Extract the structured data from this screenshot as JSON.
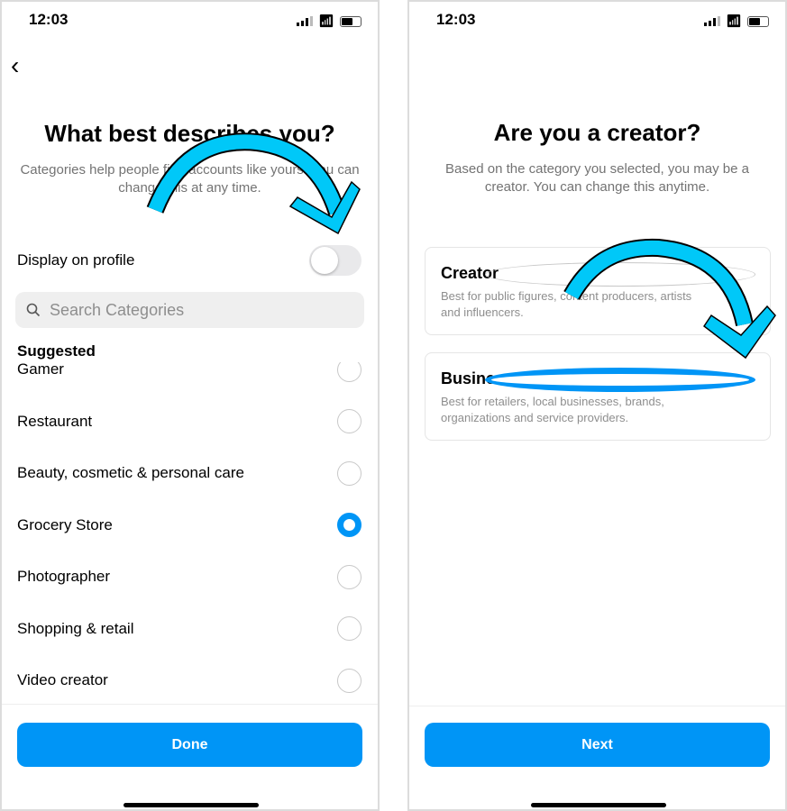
{
  "left": {
    "time": "12:03",
    "title": "What best describes you?",
    "subtitle": "Categories help people find accounts like yours. You can change this at any time.",
    "display_on_profile": "Display on profile",
    "display_on_profile_enabled": false,
    "search_placeholder": "Search Categories",
    "section": "Suggested",
    "items": [
      {
        "label": "Gamer",
        "selected": false
      },
      {
        "label": "Restaurant",
        "selected": false
      },
      {
        "label": "Beauty, cosmetic & personal care",
        "selected": false
      },
      {
        "label": "Grocery Store",
        "selected": true
      },
      {
        "label": "Photographer",
        "selected": false
      },
      {
        "label": "Shopping & retail",
        "selected": false
      },
      {
        "label": "Video creator",
        "selected": false
      }
    ],
    "button": "Done"
  },
  "right": {
    "time": "12:03",
    "title": "Are you a creator?",
    "subtitle": "Based on the category you selected, you may be a creator. You can change this anytime.",
    "options": [
      {
        "title": "Creator",
        "desc": "Best for public figures, content producers, artists and influencers.",
        "selected": false
      },
      {
        "title": "Business",
        "desc": "Best for retailers, local businesses, brands, organizations and service providers.",
        "selected": true
      }
    ],
    "button": "Next"
  },
  "colors": {
    "accent": "#0095f6",
    "arrow": "#00c8f8"
  }
}
